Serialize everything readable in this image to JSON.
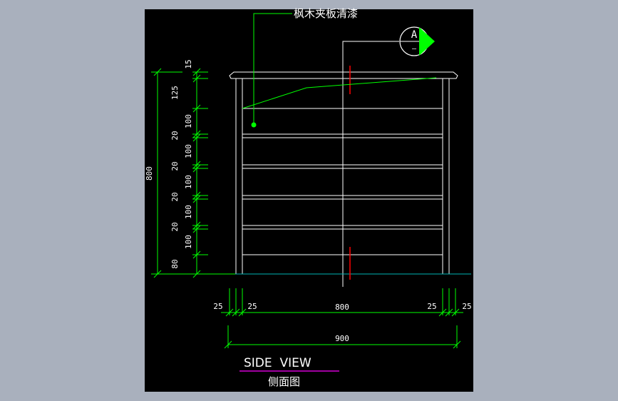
{
  "colors": {
    "background": "#a9b0bd",
    "sheet": "#000000",
    "object_lines": "#ffffff",
    "dimension_lines": "#00ff00",
    "leader": "#00ff00",
    "cut_marks": "#ff0000",
    "floor_line": "#00b4b4",
    "title_underline": "#ff00ff"
  },
  "annotation": {
    "leader_text": "枫木夹板清漆"
  },
  "section_marker": {
    "letter": "A",
    "sheet_ref": "—"
  },
  "vertical_dims": {
    "overall": "800",
    "segments": [
      "15",
      "125",
      "100",
      "20",
      "100",
      "20",
      "100",
      "20",
      "100",
      "20",
      "100",
      "80"
    ]
  },
  "horizontal_dims": {
    "left_outer": "25",
    "left_inner": "25",
    "middle": "800",
    "right_inner": "25",
    "right_outer": "25",
    "overall": "900"
  },
  "title": {
    "english": "SIDE  VIEW",
    "chinese": "侧面图"
  }
}
